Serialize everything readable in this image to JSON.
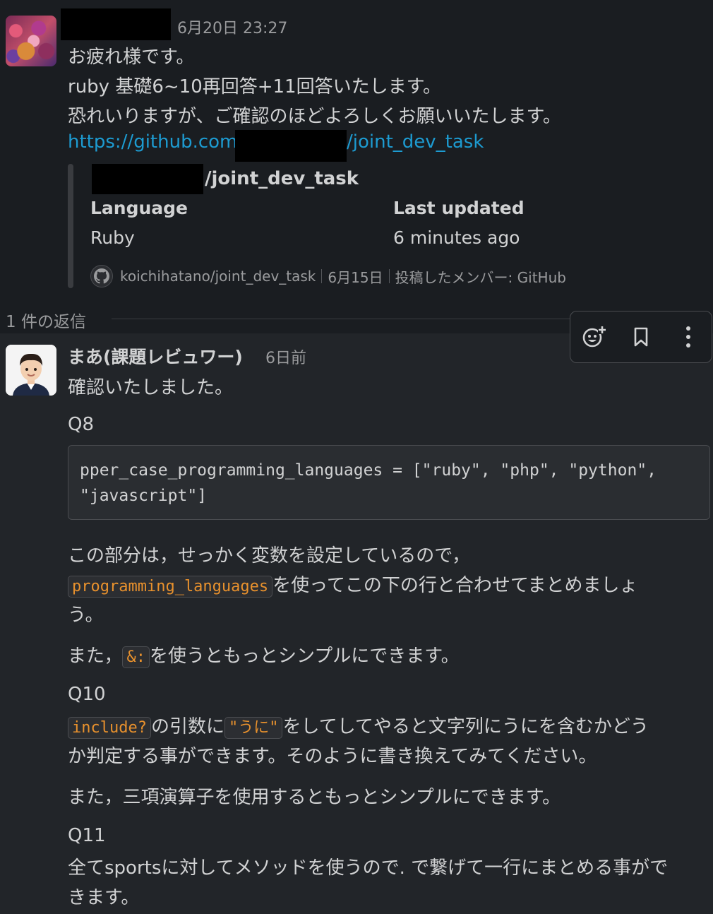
{
  "message1": {
    "timestamp": "6月20日 23:27",
    "lines": [
      "お疲れ様です。",
      "ruby 基礎6~10再回答+11回答いたします。",
      "恐れいりますが、ご確認のほどよろしくお願いいたします。"
    ],
    "link_prefix": "https://github.com/",
    "link_suffix": "/joint_dev_task",
    "unfurl": {
      "title_suffix": "/joint_dev_task",
      "language_label": "Language",
      "language_value": "Ruby",
      "updated_label": "Last updated",
      "updated_value": "6 minutes ago",
      "footer_repo": "koichihatano/joint_dev_task",
      "footer_date": "6月15日",
      "footer_poster": "投稿したメンバー: GitHub"
    }
  },
  "thread": {
    "reply_count": "1 件の返信"
  },
  "message2": {
    "author": "まあ(課題レビュワー)",
    "timestamp": "6日前",
    "greeting": "確認いたしました。",
    "q8_heading": "Q8",
    "code_line1": "pper_case_programming_languages = [\"ruby\", \"php\", \"python\",",
    "code_line2": "\"javascript\"]",
    "p1_line1": "この部分は，せっかく変数を設定しているので，",
    "p1_code": "programming_languages",
    "p1_line2_rest": "を使ってこの下の行と合わせてまとめましょ",
    "p1_line3": "う。",
    "p2_pre": "また，",
    "p2_code": "&:",
    "p2_post": "を使うともっとシンプルにできます。",
    "q10_heading": "Q10",
    "p3_code1": "include?",
    "p3_mid": "の引数に",
    "p3_code2": "\"うに\"",
    "p3_rest": "をしてしてやると文字列にうにを含むかどう",
    "p3_line2": "か判定する事ができます。そのように書き換えてみてください。",
    "p4": "また，三項演算子を使用するともっとシンプルにできます。",
    "q11_heading": "Q11",
    "p5_line1": "全てsportsに対してメソッドを使うので. で繋げて一行にまとめる事がで",
    "p5_line2": "きます。"
  },
  "toolbar": {
    "icons": [
      "add-reaction-icon",
      "bookmark-icon",
      "more-actions-icon"
    ]
  }
}
